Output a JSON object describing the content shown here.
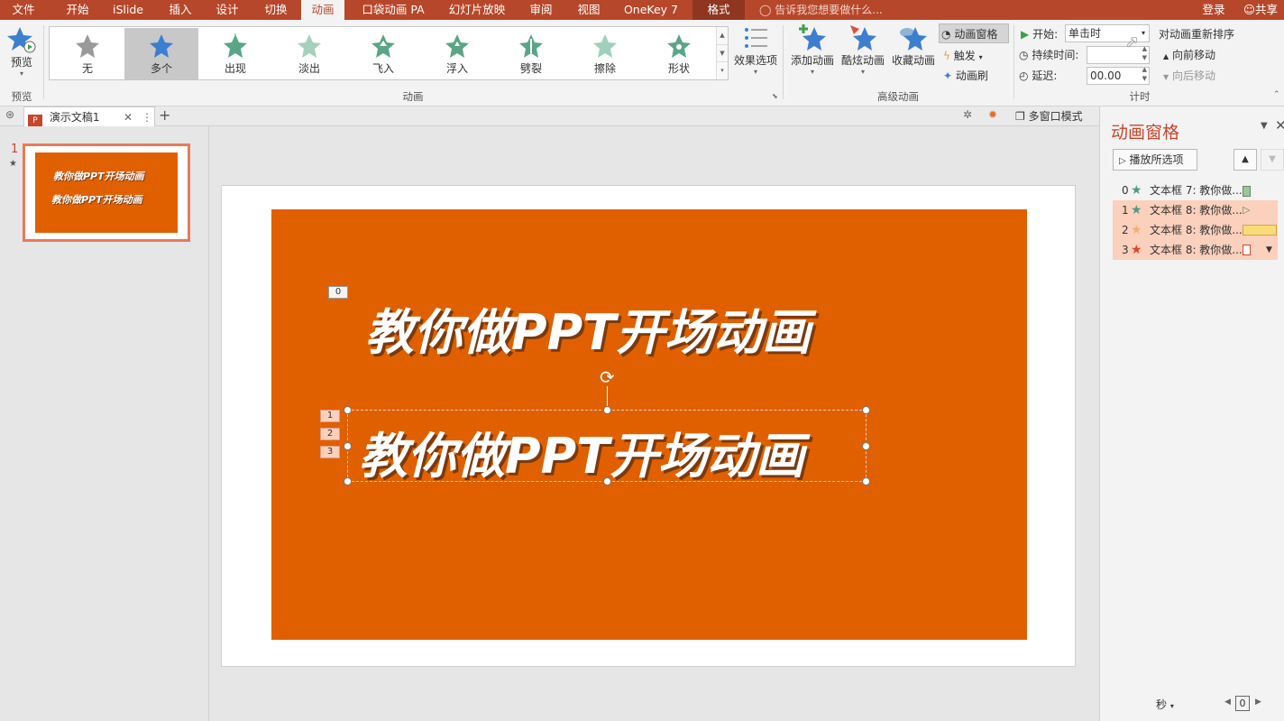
{
  "tabs": [
    {
      "id": "file",
      "label": "文件"
    },
    {
      "id": "home",
      "label": "开始"
    },
    {
      "id": "islide",
      "label": "iSlide"
    },
    {
      "id": "insert",
      "label": "插入"
    },
    {
      "id": "design",
      "label": "设计"
    },
    {
      "id": "transitions",
      "label": "切换"
    },
    {
      "id": "animations",
      "label": "动画"
    },
    {
      "id": "pocket",
      "label": "口袋动画 PA"
    },
    {
      "id": "slideshow",
      "label": "幻灯片放映"
    },
    {
      "id": "review",
      "label": "审阅"
    },
    {
      "id": "view",
      "label": "视图"
    },
    {
      "id": "onekey",
      "label": "OneKey 7"
    },
    {
      "id": "format",
      "label": "格式"
    }
  ],
  "tell_me": "告诉我您想要做什么...",
  "login": "登录",
  "share": "共享",
  "ribbon": {
    "preview": {
      "button": "预览",
      "group": "预览"
    },
    "animation_group": "动画",
    "gallery": [
      {
        "label": "无"
      },
      {
        "label": "多个"
      },
      {
        "label": "出现"
      },
      {
        "label": "淡出"
      },
      {
        "label": "飞入"
      },
      {
        "label": "浮入"
      },
      {
        "label": "劈裂"
      },
      {
        "label": "擦除"
      },
      {
        "label": "形状"
      }
    ],
    "effect_options": "效果选项",
    "advanced": {
      "group": "高级动画",
      "add": "添加动画",
      "cool": "酷炫动画",
      "fav": "收藏动画",
      "pane": "动画窗格",
      "trigger": "触发",
      "painter": "动画刷"
    },
    "timing": {
      "group": "计时",
      "start_label": "开始:",
      "start_value": "单击时",
      "duration_label": "持续时间:",
      "duration_value": "",
      "delay_label": "延迟:",
      "delay_value": "00.00",
      "reorder": "对动画重新排序",
      "move_earlier": "向前移动",
      "move_later": "向后移动"
    }
  },
  "doc": {
    "tab": "演示文稿1",
    "multiwindow": "多窗口模式"
  },
  "slide": {
    "number": "1",
    "star": "★",
    "title_text": "教你做PPT开场动画",
    "badges": [
      "0",
      "1",
      "2",
      "3"
    ]
  },
  "anim_pane": {
    "title": "动画窗格",
    "play": "播放所选项",
    "items": [
      {
        "num": "0",
        "text": "文本框 7: 教你做..."
      },
      {
        "num": "1",
        "text": "文本框 8: 教你做..."
      },
      {
        "num": "2",
        "text": "文本框 8: 教你做..."
      },
      {
        "num": "3",
        "text": "文本框 8: 教你做..."
      }
    ],
    "unit": "秒",
    "page": "0"
  },
  "colors": {
    "accent": "#b7472a",
    "slide_bg": "#e06000",
    "highlight": "#fbd0bd"
  }
}
